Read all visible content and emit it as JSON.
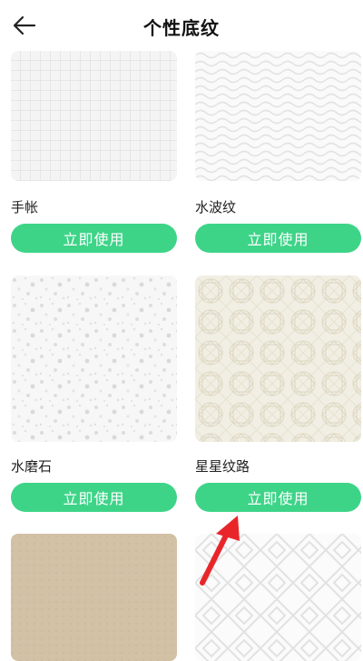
{
  "header": {
    "title": "个性底纹",
    "back_icon": "arrow-left-icon"
  },
  "themes": [
    {
      "name": "手帐",
      "button": "立即使用",
      "pattern": "grid"
    },
    {
      "name": "水波纹",
      "button": "立即使用",
      "pattern": "waves"
    },
    {
      "name": "水磨石",
      "button": "立即使用",
      "pattern": "terrazzo"
    },
    {
      "name": "星星纹路",
      "button": "立即使用",
      "pattern": "stars"
    },
    {
      "name": "",
      "button": "",
      "pattern": "kraft"
    },
    {
      "name": "",
      "button": "",
      "pattern": "greek-key"
    }
  ],
  "annotation": {
    "icon": "red-pointer-arrow-icon",
    "color": "#e8262a"
  },
  "colors": {
    "accent": "#3ed488",
    "background": "#ffffff"
  }
}
